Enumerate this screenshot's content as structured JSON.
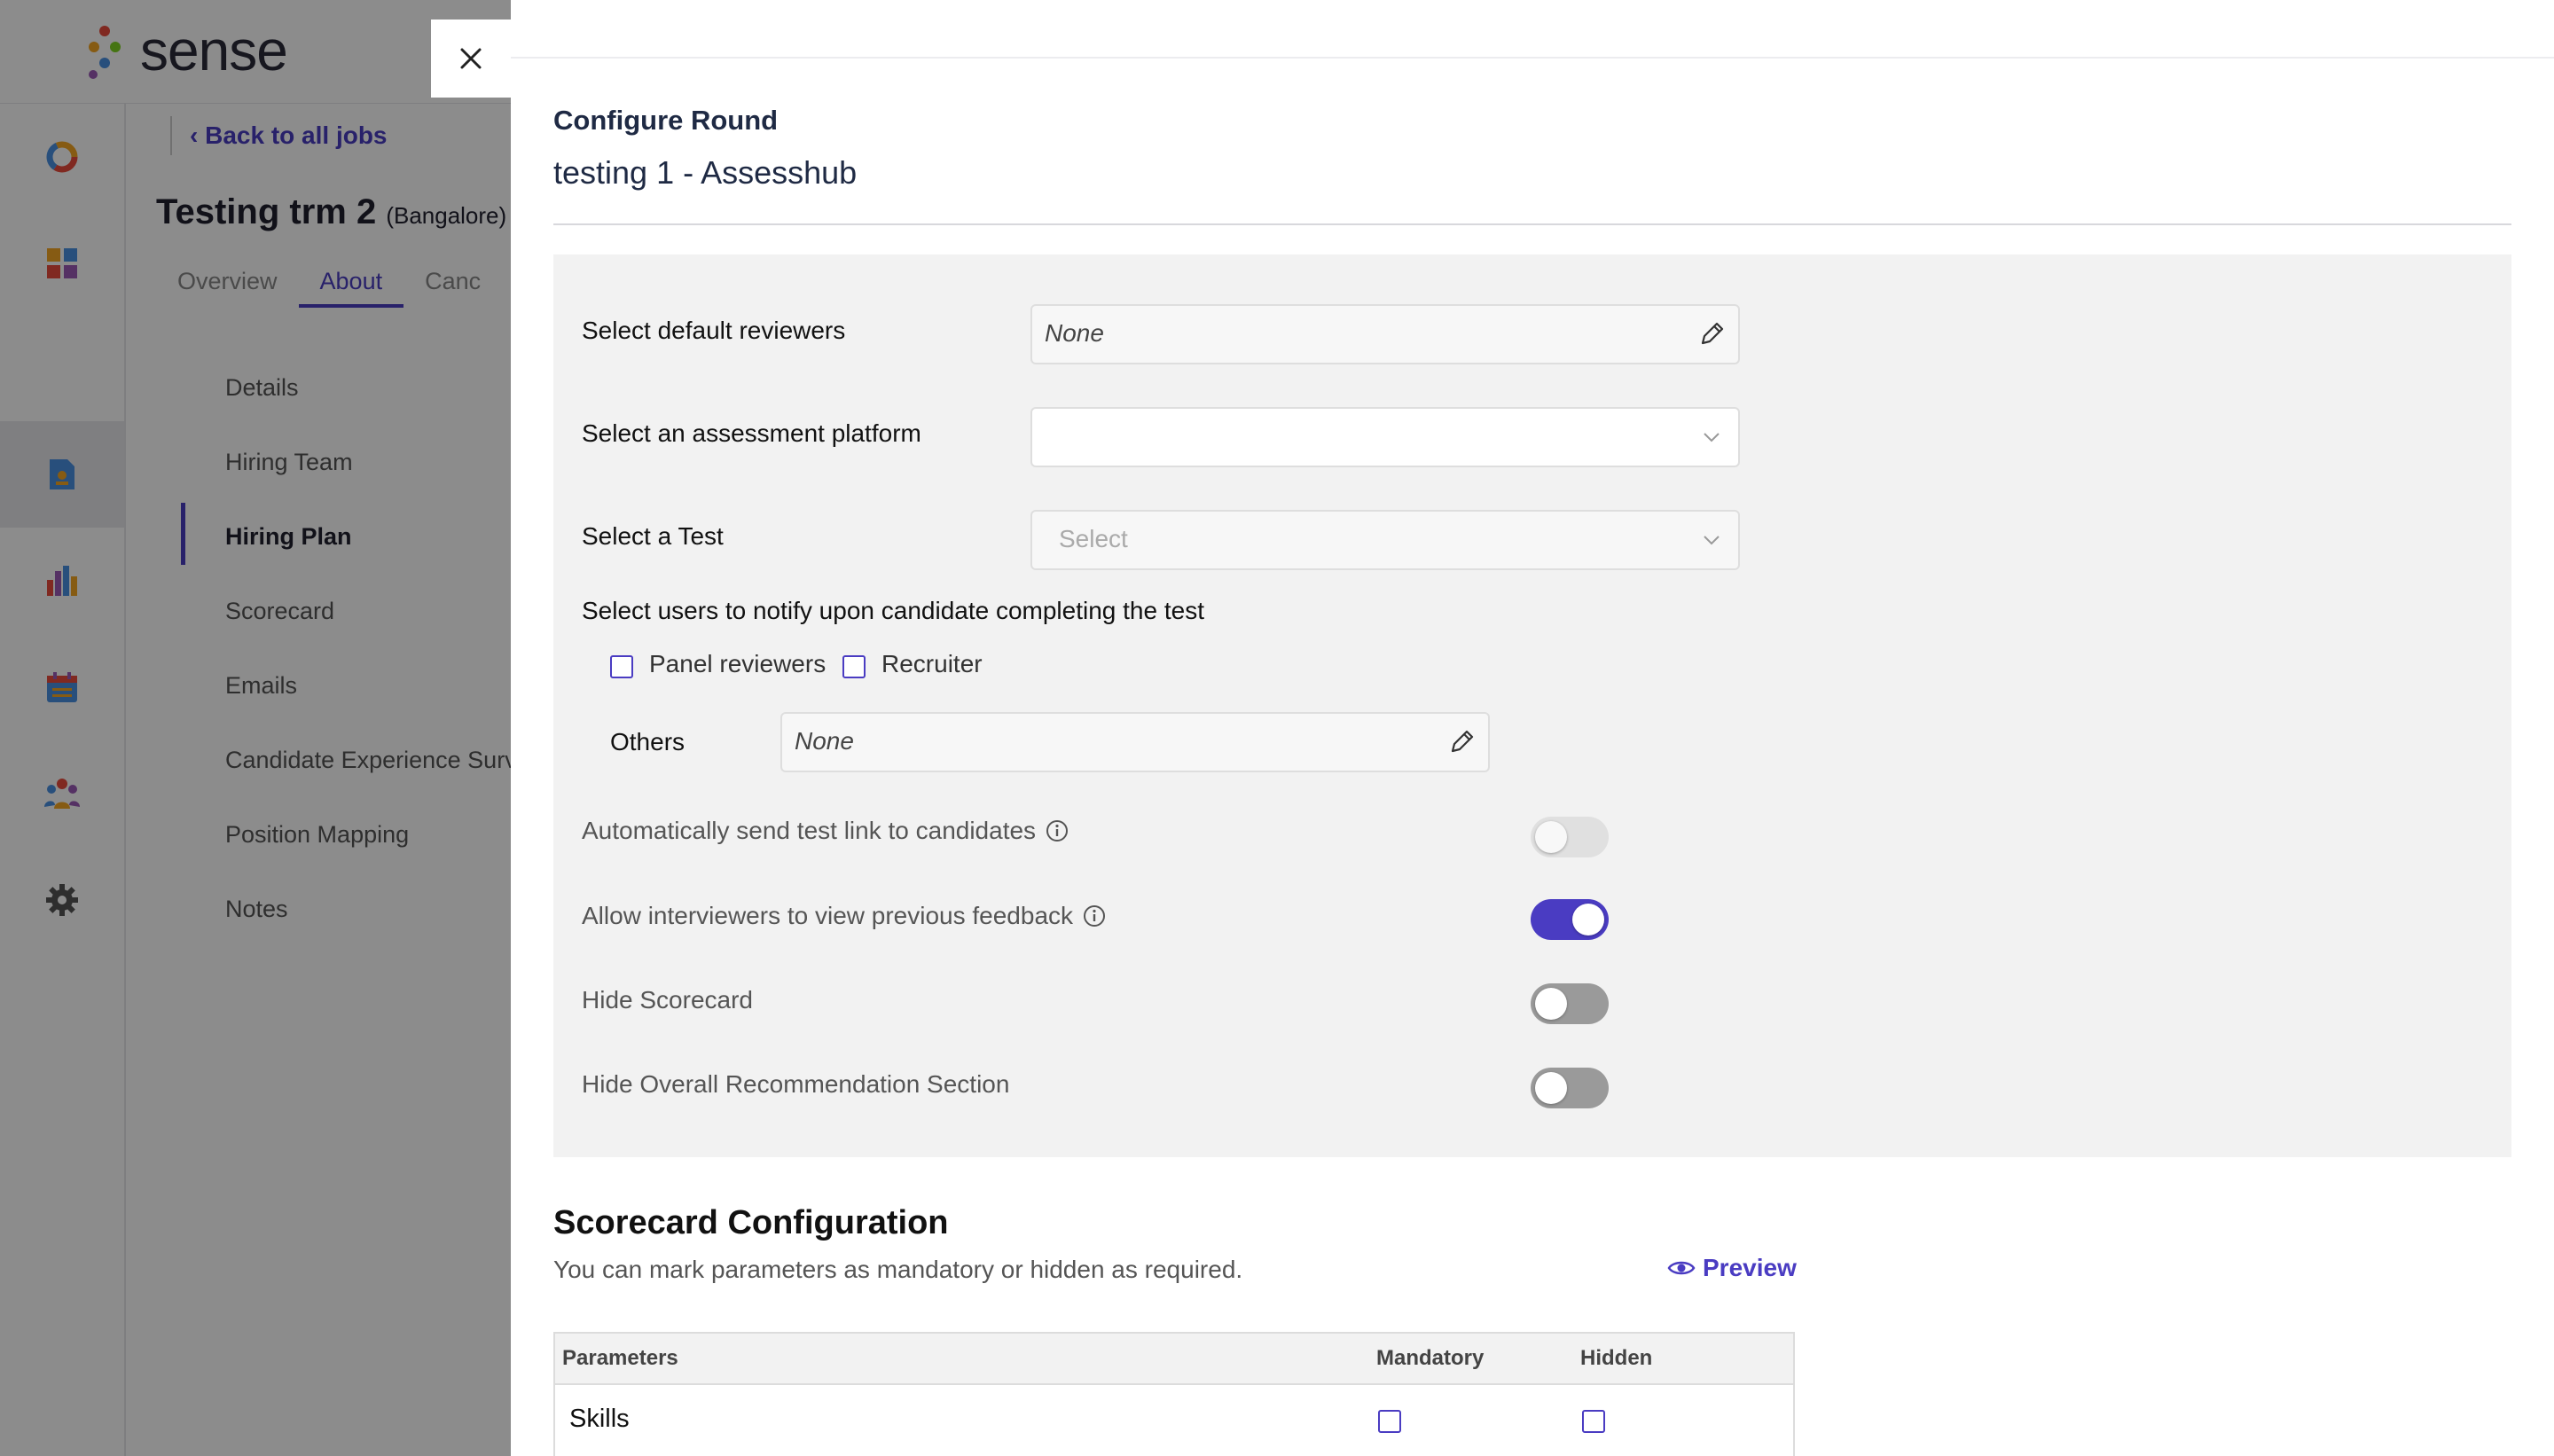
{
  "app": {
    "brand": "sense",
    "back_link": "Back to all jobs",
    "job_title": "Testing trm 2",
    "job_location": "(Bangalore)",
    "tabs": [
      "Overview",
      "About",
      "Canc"
    ],
    "active_tab": "About",
    "subnav": [
      "Details",
      "Hiring Team",
      "Hiring Plan",
      "Scorecard",
      "Emails",
      "Candidate Experience Surv",
      "Position Mapping",
      "Notes"
    ],
    "active_subnav": "Hiring Plan",
    "sidebar_icons": [
      "donut-chart-icon",
      "dashboard-grid-icon",
      "job-document-icon",
      "bar-chart-icon",
      "calendar-icon",
      "team-icon",
      "settings-gear-icon"
    ],
    "accent_color": "#4a3cc2"
  },
  "drawer": {
    "title": "Configure Round",
    "subtitle": "testing 1 - Assesshub",
    "close_icon": "close-icon",
    "fields": {
      "default_reviewers_label": "Select default reviewers",
      "default_reviewers_value": "None",
      "assessment_platform_label": "Select an assessment platform",
      "assessment_platform_value": "",
      "test_label": "Select a Test",
      "test_placeholder": "Select",
      "notify_label": "Select users to notify upon candidate completing the test",
      "notify_options": [
        {
          "label": "Panel reviewers",
          "checked": false
        },
        {
          "label": "Recruiter",
          "checked": false
        }
      ],
      "others_label": "Others",
      "others_value": "None"
    },
    "toggles": [
      {
        "label": "Automatically send test link to candidates",
        "info": true,
        "state": "off-disabled"
      },
      {
        "label": "Allow interviewers to view previous feedback",
        "info": true,
        "state": "on"
      },
      {
        "label": "Hide Scorecard",
        "info": false,
        "state": "off"
      },
      {
        "label": "Hide Overall Recommendation Section",
        "info": false,
        "state": "off"
      }
    ],
    "scorecard": {
      "title": "Scorecard Configuration",
      "description": "You can mark parameters as mandatory or hidden as required.",
      "preview_label": "Preview",
      "columns": [
        "Parameters",
        "Mandatory",
        "Hidden"
      ],
      "rows": [
        {
          "parameter": "Skills",
          "mandatory": false,
          "hidden": false
        }
      ]
    }
  }
}
